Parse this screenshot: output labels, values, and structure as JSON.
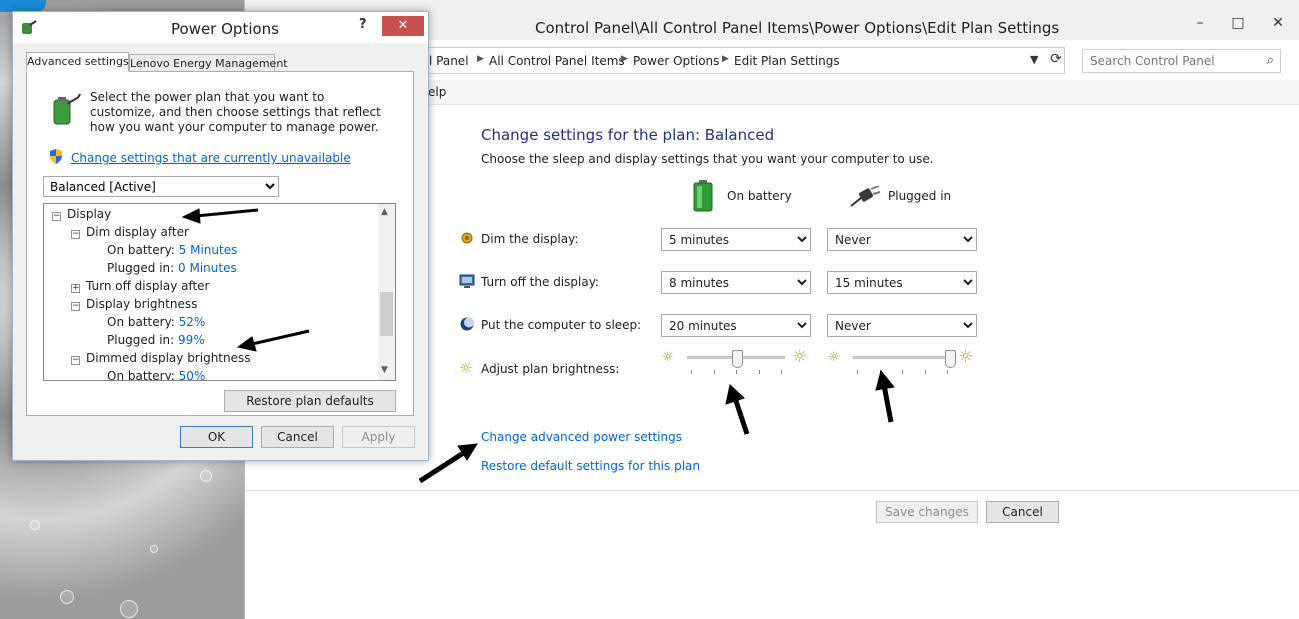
{
  "main_window": {
    "title": "Control Panel\\All Control Panel Items\\Power Options\\Edit Plan Settings",
    "caption_buttons": {
      "minimize": "–",
      "maximize": "□",
      "close": "✕"
    },
    "breadcrumb": [
      "l Panel",
      "All Control Panel Items",
      "Power Options",
      "Edit Plan Settings"
    ],
    "search_placeholder": "Search Control Panel",
    "menu": {
      "help": "elp"
    },
    "plan_title": "Change settings for the plan: Balanced",
    "plan_description": "Choose the sleep and display settings that you want your computer to use.",
    "columns": {
      "on_battery": "On battery",
      "plugged_in": "Plugged in"
    },
    "rows": [
      {
        "label": "Dim the display:",
        "battery": "5 minutes",
        "plugged": "Never",
        "icon": "dim-display-icon"
      },
      {
        "label": "Turn off the display:",
        "battery": "8 minutes",
        "plugged": "15 minutes",
        "icon": "monitor-icon"
      },
      {
        "label": "Put the computer to sleep:",
        "battery": "20 minutes",
        "plugged": "Never",
        "icon": "sleep-moon-icon"
      }
    ],
    "brightness": {
      "label": "Adjust plan brightness:",
      "battery_fraction": 0.52,
      "plugged_fraction": 0.99
    },
    "links": {
      "advanced": "Change advanced power settings",
      "restore": "Restore default settings for this plan"
    },
    "buttons": {
      "save": "Save changes",
      "cancel": "Cancel"
    }
  },
  "dialog": {
    "title": "Power Options",
    "help_glyph": "?",
    "close_glyph": "✕",
    "tabs": [
      "Advanced settings",
      "Lenovo Energy Management"
    ],
    "description": "Select the power plan that you want to customize, and then choose settings that reflect how you want your computer to manage power.",
    "change_link": "Change settings that are currently unavailable",
    "plan_selected": "Balanced [Active]",
    "tree": {
      "display": "Display",
      "dim_after": "Dim display after",
      "dim_on_battery_label": "On battery:",
      "dim_on_battery_value": "5 Minutes",
      "dim_plugged_label": "Plugged in:",
      "dim_plugged_value": "0 Minutes",
      "turn_off_after": "Turn off display after",
      "brightness": "Display brightness",
      "bright_on_battery_label": "On battery:",
      "bright_on_battery_value": "52%",
      "bright_plugged_label": "Plugged in:",
      "bright_plugged_value": "99%",
      "dimmed_brightness": "Dimmed display brightness",
      "dimmed_on_battery_label": "On battery:",
      "dimmed_on_battery_value": "50%"
    },
    "buttons": {
      "restore": "Restore plan defaults",
      "ok": "OK",
      "cancel": "Cancel",
      "apply": "Apply"
    }
  }
}
